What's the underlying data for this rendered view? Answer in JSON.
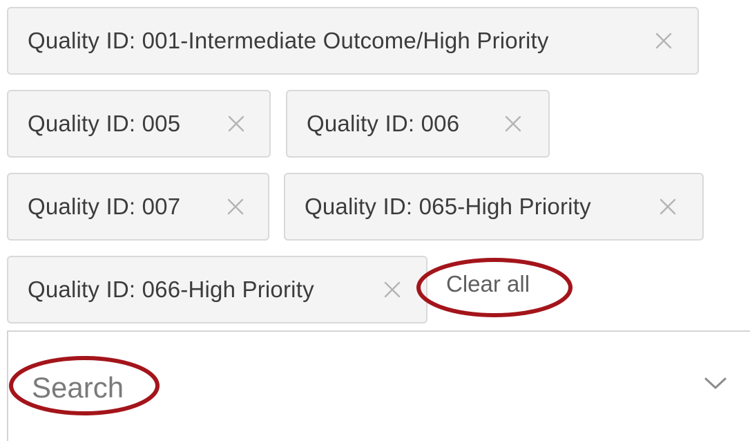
{
  "chips": [
    {
      "label": "Quality ID: 001-Intermediate Outcome/High Priority",
      "remove_icon": "close-icon"
    },
    {
      "label": "Quality ID: 005",
      "remove_icon": "close-icon"
    },
    {
      "label": "Quality ID: 006",
      "remove_icon": "close-icon"
    },
    {
      "label": "Quality ID: 007",
      "remove_icon": "close-icon"
    },
    {
      "label": "Quality ID: 065-High Priority",
      "remove_icon": "close-icon"
    },
    {
      "label": "Quality ID: 066-High Priority",
      "remove_icon": "close-icon"
    }
  ],
  "clear_all": {
    "label": "Clear all"
  },
  "search": {
    "placeholder": "Search",
    "value": "",
    "toggle_icon": "chevron-down-icon"
  },
  "colors": {
    "chip_background": "#f4f4f4",
    "chip_border": "#d9d9d9",
    "chip_text": "#3c3c3c",
    "remove_icon": "#b4b4b4",
    "annotation_circle": "#a3151b"
  }
}
